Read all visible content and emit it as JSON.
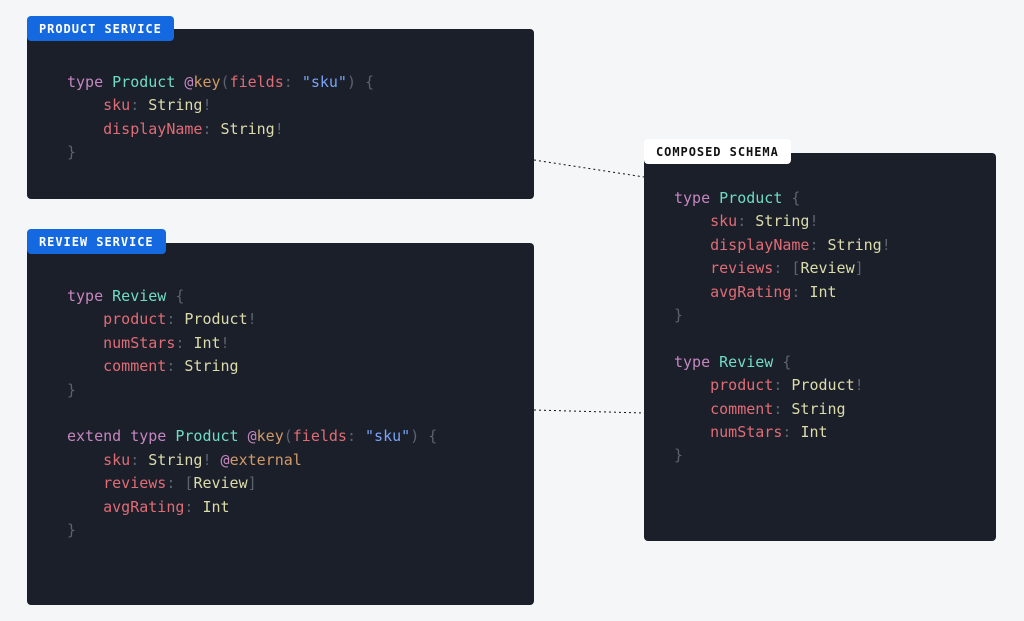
{
  "product_service": {
    "badge": "PRODUCT SERVICE",
    "l1_kw": "type",
    "l1_ty": "Product",
    "l1_at": "@",
    "l1_dir": "key",
    "l1_lp": "(",
    "l1_pn": "fields",
    "l1_colon": ":",
    "l1_sp1": " ",
    "l1_str": "\"sku\"",
    "l1_rp": ")",
    "l1_sp2": " ",
    "l1_lb": "{",
    "l2_field": "sku",
    "l2_colon": ":",
    "l2_sp": " ",
    "l2_tn": "String",
    "l2_bang": "!",
    "l3_field": "displayName",
    "l3_colon": ":",
    "l3_sp": " ",
    "l3_tn": "String",
    "l3_bang": "!",
    "l4_rb": "}"
  },
  "review_service": {
    "badge": "REVIEW SERVICE",
    "r1_kw": "type",
    "r1_ty": "Review",
    "r1_sp": " ",
    "r1_lb": "{",
    "r2_field": "product",
    "r2_colon": ":",
    "r2_sp": " ",
    "r2_tn": "Product",
    "r2_bang": "!",
    "r3_field": "numStars",
    "r3_colon": ":",
    "r3_sp": " ",
    "r3_tn": "Int",
    "r3_bang": "!",
    "r4_field": "comment",
    "r4_colon": ":",
    "r4_sp": " ",
    "r4_tn": "String",
    "r5_rb": "}",
    "e1_ext": "extend",
    "e1_kw": "type",
    "e1_ty": "Product",
    "e1_at": "@",
    "e1_dir": "key",
    "e1_lp": "(",
    "e1_pn": "fields",
    "e1_colon": ":",
    "e1_sp1": " ",
    "e1_str": "\"sku\"",
    "e1_rp": ")",
    "e1_sp2": " ",
    "e1_lb": "{",
    "e2_field": "sku",
    "e2_colon": ":",
    "e2_sp": " ",
    "e2_tn": "String",
    "e2_bang": "!",
    "e2_sp2": " ",
    "e2_at": "@",
    "e2_dir": "external",
    "e3_field": "reviews",
    "e3_colon": ":",
    "e3_sp": " ",
    "e3_lb": "[",
    "e3_tn": "Review",
    "e3_rb": "]",
    "e4_field": "avgRating",
    "e4_colon": ":",
    "e4_sp": " ",
    "e4_tn": "Int",
    "e5_rb": "}"
  },
  "composed": {
    "badge": "COMPOSED SCHEMA",
    "p1_kw": "type",
    "p1_ty": "Product",
    "p1_sp": " ",
    "p1_lb": "{",
    "p2_field": "sku",
    "p2_colon": ":",
    "p2_sp": " ",
    "p2_tn": "String",
    "p2_bang": "!",
    "p3_field": "displayName",
    "p3_colon": ":",
    "p3_sp": " ",
    "p3_tn": "String",
    "p3_bang": "!",
    "p4_field": "reviews",
    "p4_colon": ":",
    "p4_sp": " ",
    "p4_lb": "[",
    "p4_tn": "Review",
    "p4_rb": "]",
    "p5_field": "avgRating",
    "p5_colon": ":",
    "p5_sp": " ",
    "p5_tn": "Int",
    "p6_rb": "}",
    "v1_kw": "type",
    "v1_ty": "Review",
    "v1_sp": " ",
    "v1_lb": "{",
    "v2_field": "product",
    "v2_colon": ":",
    "v2_sp": " ",
    "v2_tn": "Product",
    "v2_bang": "!",
    "v3_field": "comment",
    "v3_colon": ":",
    "v3_sp": " ",
    "v3_tn": "String",
    "v4_field": "numStars",
    "v4_colon": ":",
    "v4_sp": " ",
    "v4_tn": "Int",
    "v5_rb": "}"
  }
}
